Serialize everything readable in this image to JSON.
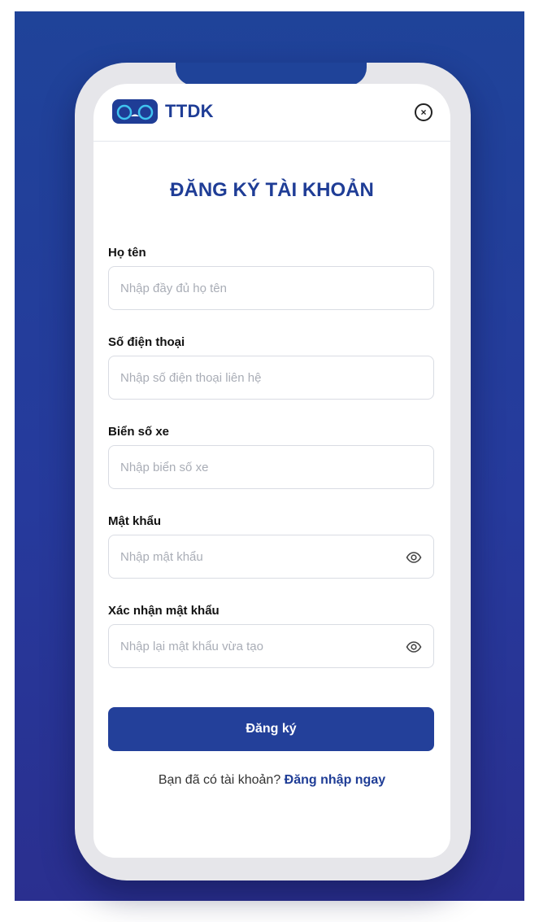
{
  "header": {
    "brand": "TTDK",
    "logo_icon": "vr-goggles-icon",
    "close_icon": "close-circle-icon",
    "close_glyph": "×"
  },
  "form": {
    "title": "ĐĂNG KÝ TÀI KHOẢN",
    "fields": [
      {
        "label": "Họ tên",
        "placeholder": "Nhập đầy đủ họ tên",
        "value": ""
      },
      {
        "label": "Số điện thoại",
        "placeholder": "Nhập số điện thoại liên hệ",
        "value": ""
      },
      {
        "label": "Biển số xe",
        "placeholder": "Nhập biển số xe",
        "value": ""
      },
      {
        "label": "Mật khẩu",
        "placeholder": "Nhập mật khẩu",
        "value": "",
        "icon": "eye-icon"
      },
      {
        "label": "Xác nhận mật khẩu",
        "placeholder": "Nhập lại mật khẩu vừa tạo",
        "value": "",
        "icon": "eye-icon"
      }
    ],
    "submit_label": "Đăng ký"
  },
  "footer": {
    "prompt": "Bạn đã có tài khoản?",
    "login_link": "Đăng nhập ngay"
  },
  "colors": {
    "background_top": "#1f4399",
    "background_bottom": "#2a2f8f",
    "brand": "#1f3d96",
    "button": "#23409a",
    "phone_frame": "#e6e6ea"
  }
}
